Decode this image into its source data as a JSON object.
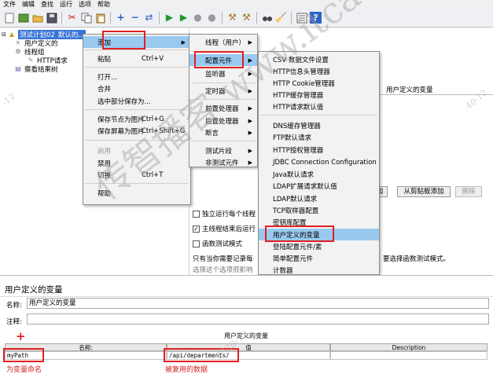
{
  "menubar": [
    "文件",
    "编辑",
    "查找",
    "运行",
    "选项",
    "帮助"
  ],
  "toolbar_icons": [
    "new-file-icon",
    "templates-icon",
    "open-icon",
    "save-icon",
    "cut-icon",
    "copy-icon",
    "paste-icon",
    "expand-icon",
    "collapse-icon",
    "toggle-icon",
    "start-icon",
    "start-no-pause-icon",
    "stop-icon",
    "shutdown-icon",
    "clear-icon",
    "clear-all-icon",
    "search-icon",
    "reset-search-icon",
    "function-helper-icon",
    "help-icon"
  ],
  "tree": {
    "root": "测试计划02",
    "root_tail": "默认的...",
    "items": [
      "用户定义的",
      "线程组",
      "HTTP请求",
      "察看结果树"
    ]
  },
  "context_menu": {
    "add": "添加",
    "paste": "粘贴",
    "paste_shortcut": "Ctrl+V",
    "open": "打开...",
    "merge": "合并",
    "save_selection": "选中部分保存为...",
    "save_node_image": "保存节点为图片",
    "save_node_image_shortcut": "Ctrl+G",
    "save_screen_image": "保存屏幕为图片",
    "save_screen_image_shortcut": "Ctrl+Shift+G",
    "enable": "启用",
    "disable": "禁用",
    "toggle": "切换",
    "toggle_shortcut": "Ctrl+T",
    "help": "帮助"
  },
  "add_submenu": [
    "线程（用户）",
    "配置元件",
    "监听器",
    "定时器",
    "前置处理器",
    "后置处理器",
    "断言",
    "测试片段",
    "非测试元件"
  ],
  "config_submenu": [
    "CSV 数据文件设置",
    "HTTP信息头管理器",
    "HTTP Cookie管理器",
    "HTTP缓存管理器",
    "HTTP请求默认值",
    "DNS缓存管理器",
    "FTP默认请求",
    "HTTP授权管理器",
    "JDBC Connection Configuration",
    "Java默认请求",
    "LDAP扩展请求默认值",
    "LDAP默认请求",
    "TCP取样器配置",
    "密钥库配置",
    "用户定义的变量",
    "登陆配置元件/素",
    "简单配置元件",
    "计数器"
  ],
  "right_panel": {
    "vars_header": "用户定义的变量",
    "add_button": "加",
    "clipboard_add_button": "从剪贴板添加",
    "delete_button": "删除",
    "checkbox_independent": "独立运行每个线程",
    "checkbox_main_end": "主线程结束后运行",
    "checkbox_function": "函数测试模式",
    "hint_line1": "只有当你需要记录每",
    "hint_line1_tail": "要选择函数测试模式。",
    "hint_line2": "选择这个选项很影响"
  },
  "editor": {
    "title": "用户定义的变量",
    "name_label": "名称:",
    "name_value": "用户定义的变量",
    "comment_label": "注释:",
    "table_title": "用户定义的变量",
    "add_plus": "+",
    "col_name": "名称:",
    "col_value": "值",
    "col_description": "Description",
    "row_name": "myPath",
    "row_value": "/api/departments/",
    "annotation_name": "为变量命名",
    "annotation_value": "被复用的数据"
  },
  "watermark": {
    "main": "传智播客 www.itcast.cn",
    "date1": "2020-12",
    "date2": "-12",
    "date3": "40-12"
  },
  "colors": {
    "highlight_red": "#e02020",
    "menu_select": "#99c9ef",
    "tree_select": "#3875d7"
  }
}
